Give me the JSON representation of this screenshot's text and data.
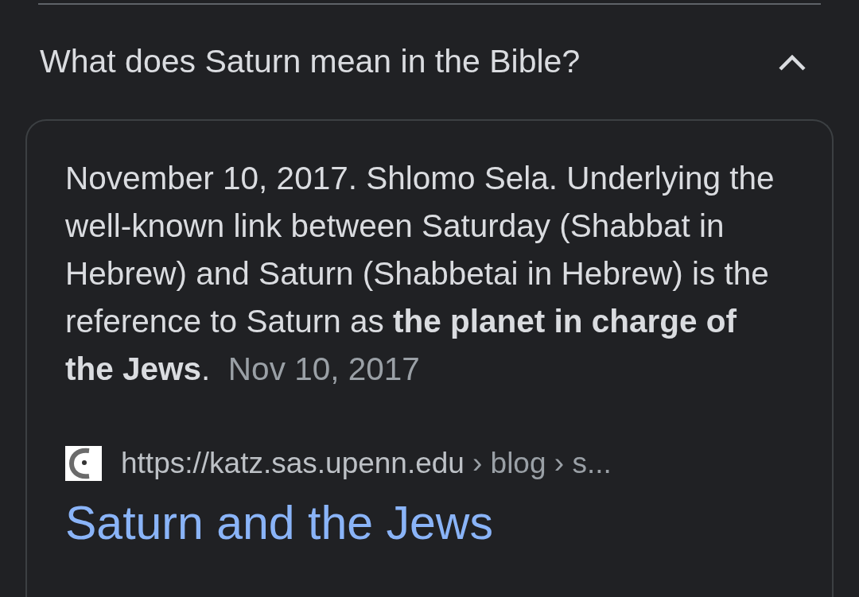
{
  "question": {
    "text": "What does Saturn mean in the Bible?",
    "expanded": true
  },
  "answer": {
    "snippet": "November 10, 2017. Shlomo Sela. Underlying the well-known link between Saturday (Shabbat in Hebrew) and Saturn (Shabbetai in Hebrew) is the reference to Saturn as **the planet in charge of the Jews**.",
    "date": "Nov 10, 2017",
    "source": {
      "url": "https://katz.sas.upenn.edu",
      "path": "› blog › s...",
      "title": "Saturn and the Jews"
    }
  }
}
